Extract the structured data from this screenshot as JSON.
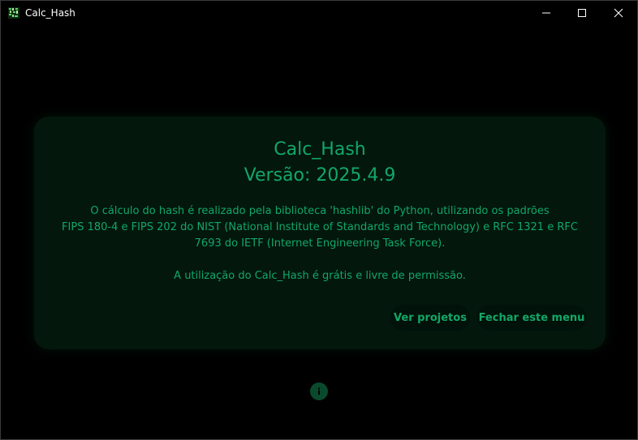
{
  "window": {
    "title": "Calc_Hash"
  },
  "dialog": {
    "app_name": "Calc_Hash",
    "version": "Versão: 2025.4.9",
    "description_lines": [
      "O cálculo do hash é realizado pela biblioteca 'hashlib' do Python, utilizando os padrões",
      "FIPS 180-4 e FIPS 202 do NIST (National Institute of Standards and Technology) e RFC 1321 e RFC",
      "7693 do IETF (Internet Engineering Task Force)."
    ],
    "license_text": "A utilização do Calc_Hash é grátis e livre de permissão.",
    "buttons": {
      "projects_label": "Ver projetos",
      "close_label": "Fechar este menu"
    }
  },
  "icons": {
    "app": "app-icon",
    "minimize": "minimize-icon",
    "maximize": "maximize-icon",
    "close": "close-icon",
    "info": "info-icon"
  },
  "colors": {
    "background": "#000000",
    "card": "#03170d",
    "accent": "#12a768",
    "button_bg": "#001209",
    "info_bg": "#0a4a2c"
  }
}
